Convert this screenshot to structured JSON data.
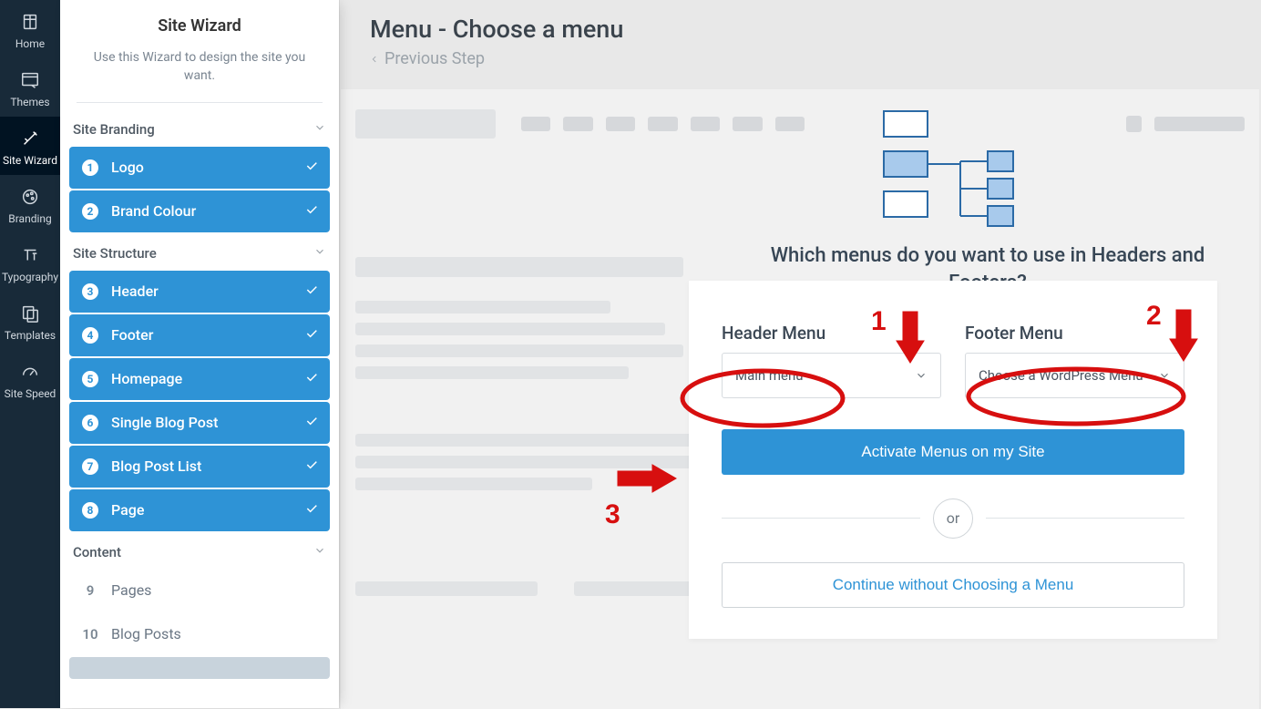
{
  "rail": {
    "items": [
      {
        "label": "Home",
        "name": "rail-home",
        "icon": "home"
      },
      {
        "label": "Themes",
        "name": "rail-themes",
        "icon": "themes"
      },
      {
        "label": "Site Wizard",
        "name": "rail-sitewizard",
        "icon": "wizard"
      },
      {
        "label": "Branding",
        "name": "rail-branding",
        "icon": "branding"
      },
      {
        "label": "Typography",
        "name": "rail-typography",
        "icon": "typography"
      },
      {
        "label": "Templates",
        "name": "rail-templates",
        "icon": "templates"
      },
      {
        "label": "Site Speed",
        "name": "rail-sitespeed",
        "icon": "speed"
      }
    ],
    "activeIndex": 2
  },
  "wizard": {
    "title": "Site Wizard",
    "subtitle": "Use this Wizard to design the site you want.",
    "groups": {
      "branding": {
        "title": "Site Branding"
      },
      "structure": {
        "title": "Site Structure"
      },
      "content": {
        "title": "Content"
      }
    },
    "steps": {
      "s1": {
        "num": "1",
        "label": "Logo"
      },
      "s2": {
        "num": "2",
        "label": "Brand Colour"
      },
      "s3": {
        "num": "3",
        "label": "Header"
      },
      "s4": {
        "num": "4",
        "label": "Footer"
      },
      "s5": {
        "num": "5",
        "label": "Homepage"
      },
      "s6": {
        "num": "6",
        "label": "Single Blog Post"
      },
      "s7": {
        "num": "7",
        "label": "Blog Post List"
      },
      "s8": {
        "num": "8",
        "label": "Page"
      },
      "s9": {
        "num": "9",
        "label": "Pages"
      },
      "s10": {
        "num": "10",
        "label": "Blog Posts"
      }
    }
  },
  "page": {
    "title": "Menu - Choose a menu",
    "previous": "Previous Step",
    "question": "Which menus do you want to use in Headers and Footers?"
  },
  "form": {
    "header_menu": {
      "label": "Header Menu",
      "value": "Main menu"
    },
    "footer_menu": {
      "label": "Footer Menu",
      "value": "Choose a WordPress Menu"
    },
    "primary_button": "Activate Menus on my Site",
    "or": "or",
    "secondary_button": "Continue without Choosing a Menu"
  },
  "annotations": {
    "n1": "1",
    "n2": "2",
    "n3": "3"
  }
}
